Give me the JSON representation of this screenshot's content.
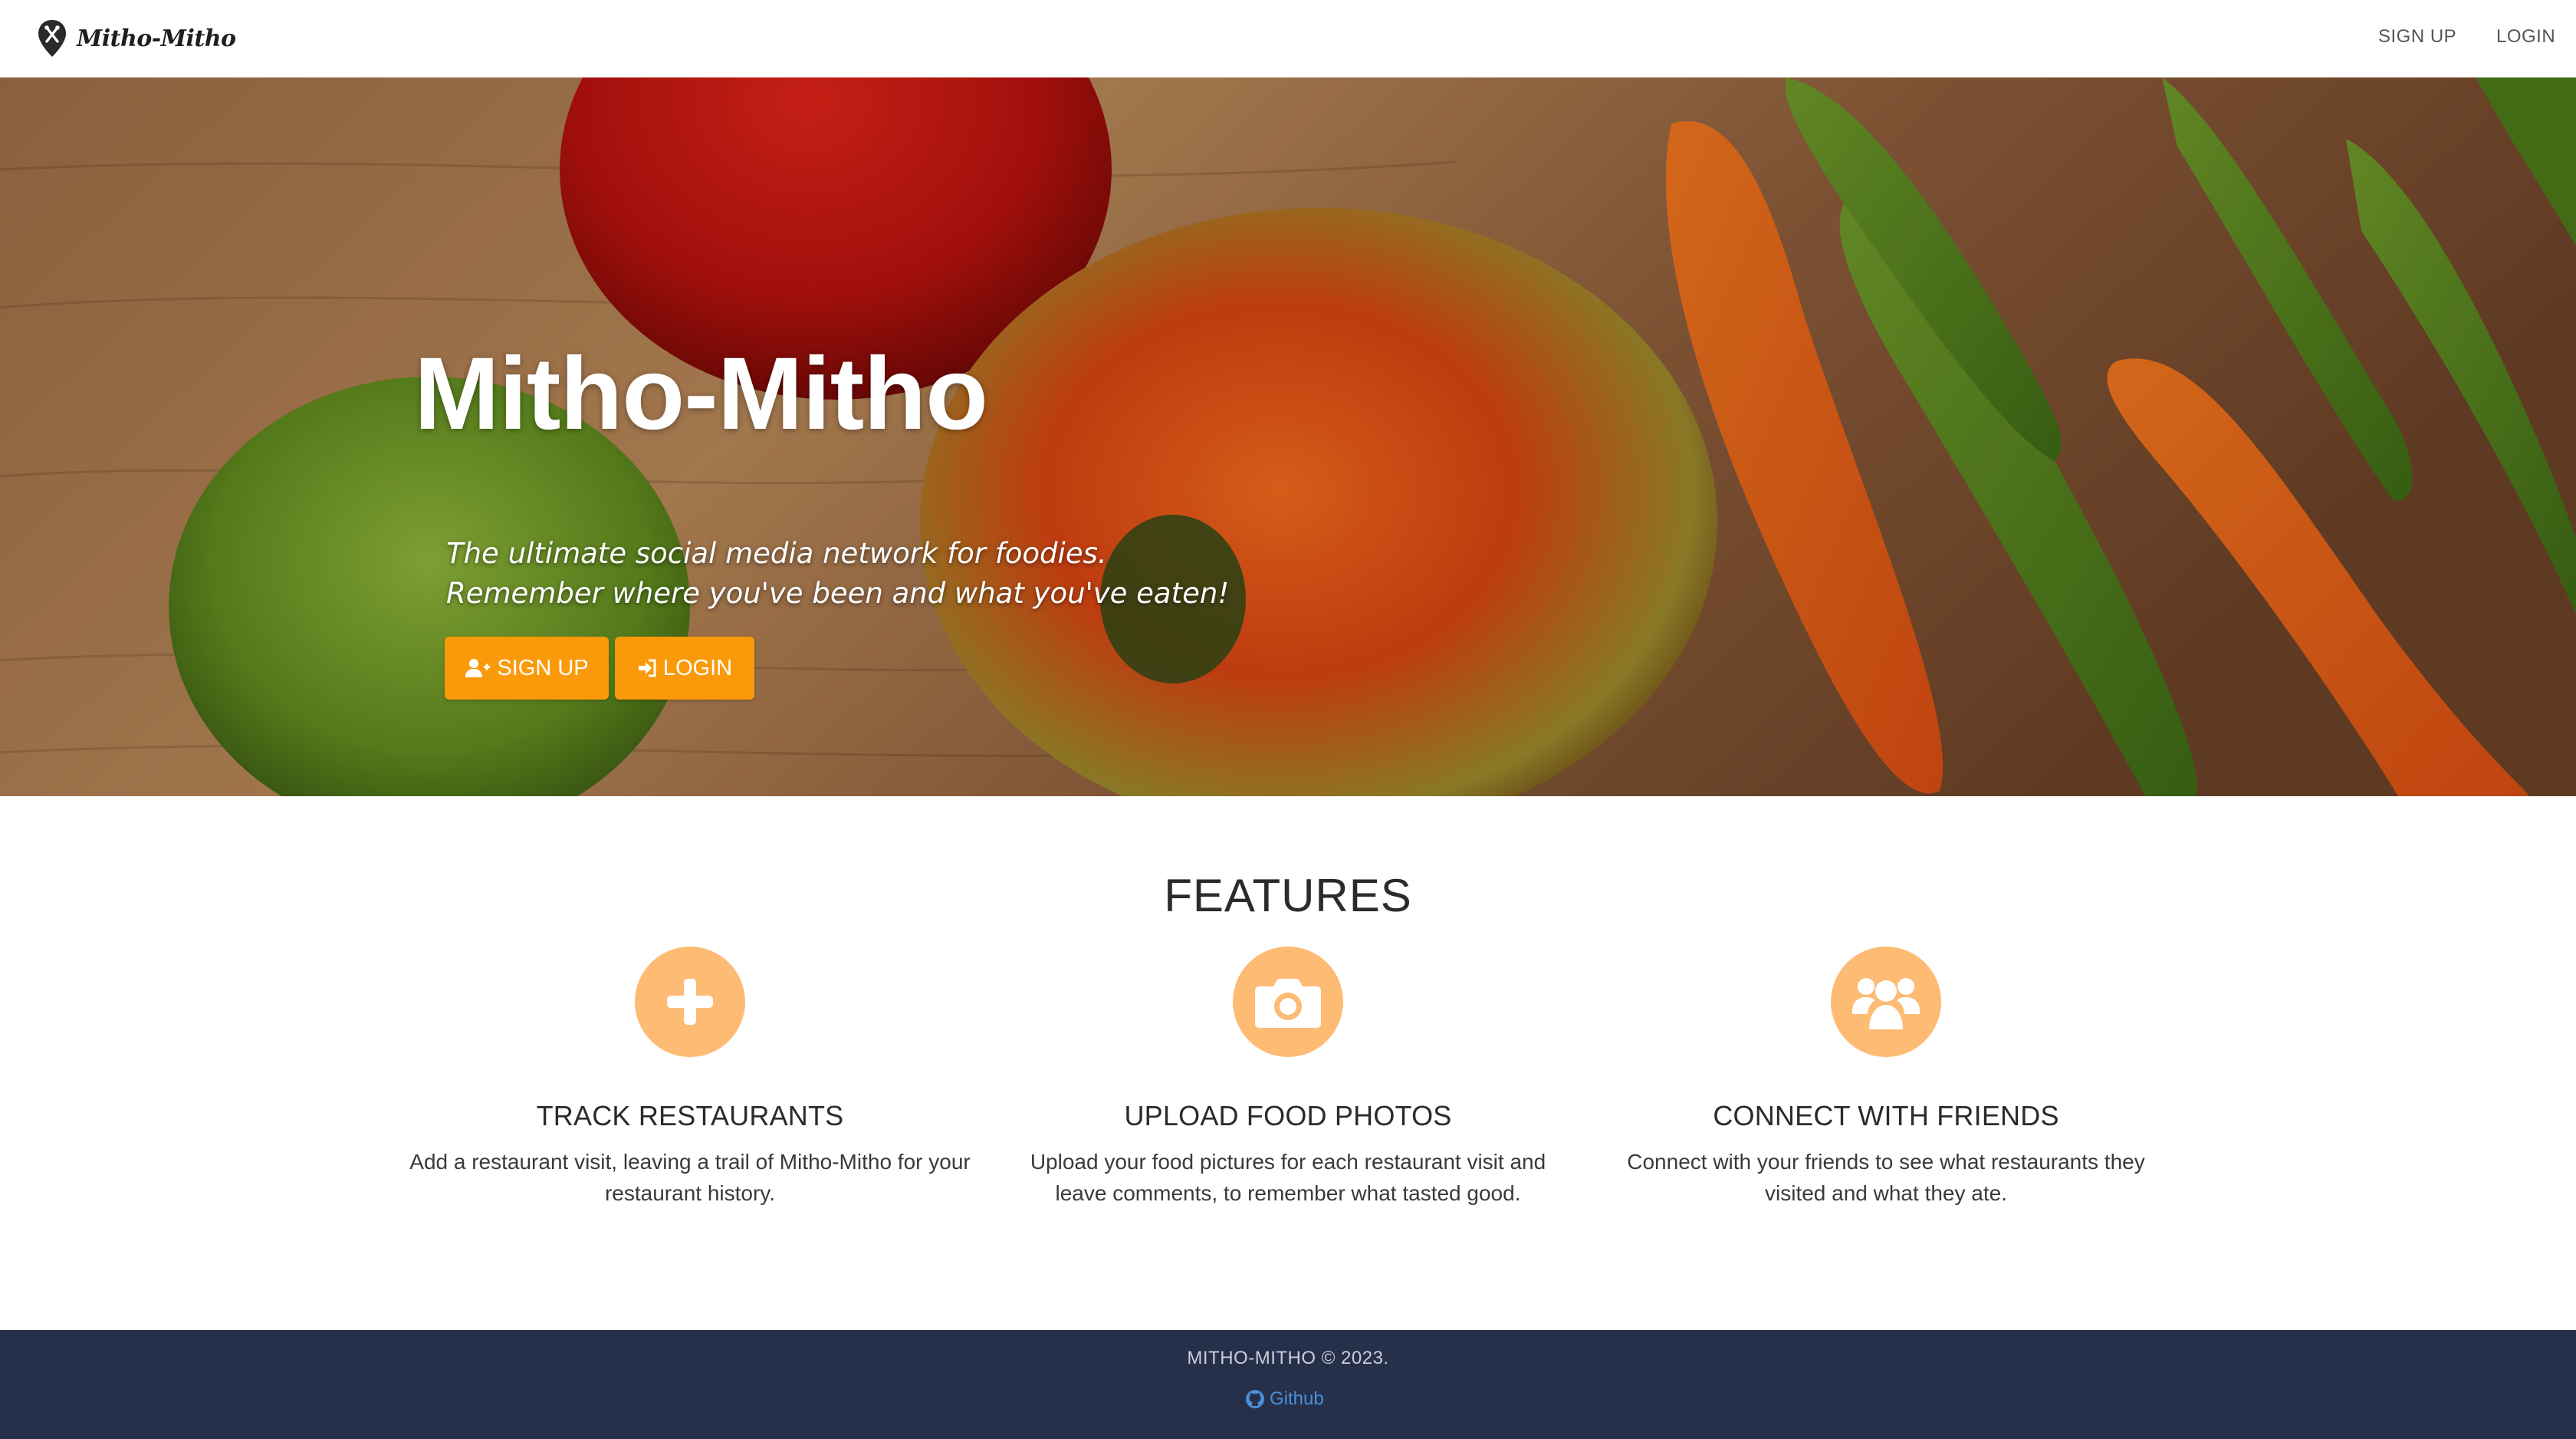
{
  "navbar": {
    "brand": "Mitho-Mitho",
    "signup_label": "SIGN UP",
    "login_label": "LOGIN"
  },
  "hero": {
    "title": "Mitho-Mitho",
    "tagline_line1": "The ultimate social media network for foodies.",
    "tagline_line2": "Remember where you've been and what you've eaten!",
    "signup_button": "SIGN UP",
    "login_button": "LOGIN",
    "background_image": "vegetables-peppers-on-wood-table"
  },
  "features": {
    "title": "FEATURES",
    "items": [
      {
        "icon": "plus-icon",
        "title": "TRACK RESTAURANTS",
        "description": "Add a restaurant visit, leaving a trail of Mitho-Mitho for your restaurant history."
      },
      {
        "icon": "camera-icon",
        "title": "UPLOAD FOOD PHOTOS",
        "description": "Upload your food pictures for each restaurant visit and leave comments, to remember what tasted good."
      },
      {
        "icon": "users-icon",
        "title": "CONNECT WITH FRIENDS",
        "description": "Connect with your friends to see what restaurants they visited and what they ate."
      }
    ]
  },
  "footer": {
    "copyright": "MITHO-MITHO © 2023.",
    "github_label": "Github"
  },
  "colors": {
    "accent": "#fa9a0a",
    "feature_circle": "#fdbb73",
    "footer_bg": "#26304a",
    "link": "#4a90d9"
  }
}
